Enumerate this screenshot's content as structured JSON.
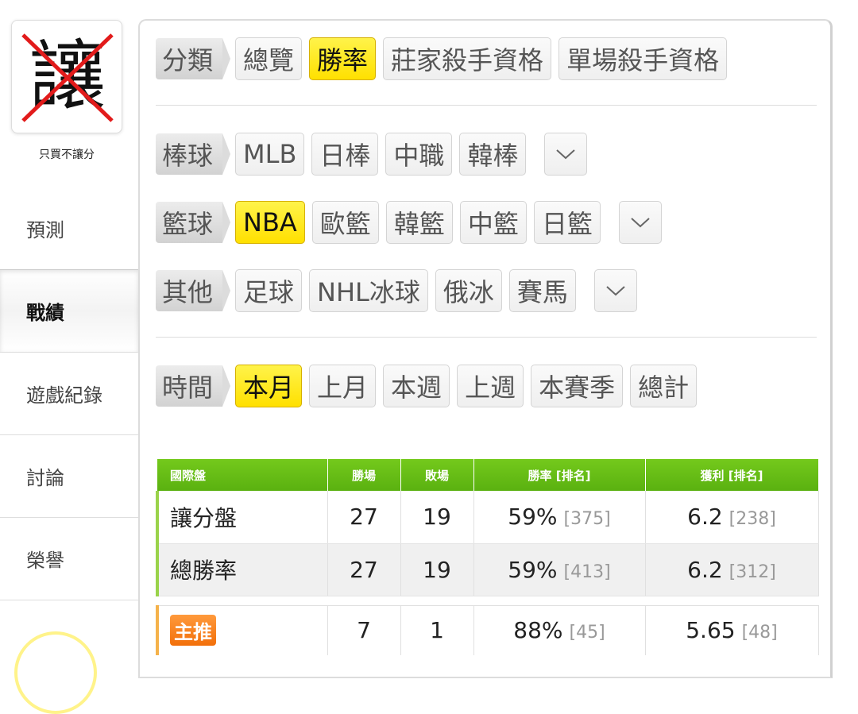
{
  "sidebar": {
    "avatar_char": "讓",
    "avatar_caption": "只買不讓分",
    "nav": [
      "預測",
      "戰績",
      "遊戲紀錄",
      "討論",
      "榮譽"
    ],
    "active_nav": "戰績"
  },
  "filters": {
    "category": {
      "label": "分類",
      "options": [
        "總覽",
        "勝率",
        "莊家殺手資格",
        "單場殺手資格"
      ],
      "selected": "勝率"
    },
    "baseball": {
      "label": "棒球",
      "options": [
        "MLB",
        "日棒",
        "中職",
        "韓棒"
      ]
    },
    "basketball": {
      "label": "籃球",
      "options": [
        "NBA",
        "歐籃",
        "韓籃",
        "中籃",
        "日籃"
      ],
      "selected": "NBA"
    },
    "other": {
      "label": "其他",
      "options": [
        "足球",
        "NHL冰球",
        "俄冰",
        "賽馬"
      ]
    },
    "time": {
      "label": "時間",
      "options": [
        "本月",
        "上月",
        "本週",
        "上週",
        "本賽季",
        "總計"
      ],
      "selected": "本月"
    }
  },
  "table": {
    "headers": [
      "國際盤",
      "勝場",
      "敗場",
      "勝率 [排名]",
      "獲利 [排名]"
    ],
    "rows": [
      {
        "name": "讓分盤",
        "wins": "27",
        "losses": "19",
        "win_rate": "59%",
        "win_rank": "[375]",
        "profit": "6.2",
        "profit_rank": "[238]"
      },
      {
        "name": "總勝率",
        "wins": "27",
        "losses": "19",
        "win_rate": "59%",
        "win_rank": "[413]",
        "profit": "6.2",
        "profit_rank": "[312]"
      }
    ],
    "featured": {
      "badge": "主推",
      "wins": "7",
      "losses": "1",
      "win_rate": "88%",
      "win_rank": "[45]",
      "profit": "5.65",
      "profit_rank": "[48]"
    }
  },
  "colors": {
    "active_chip": "#ffe000",
    "table_header": "#5ab110",
    "badge": "#f26f0a"
  }
}
